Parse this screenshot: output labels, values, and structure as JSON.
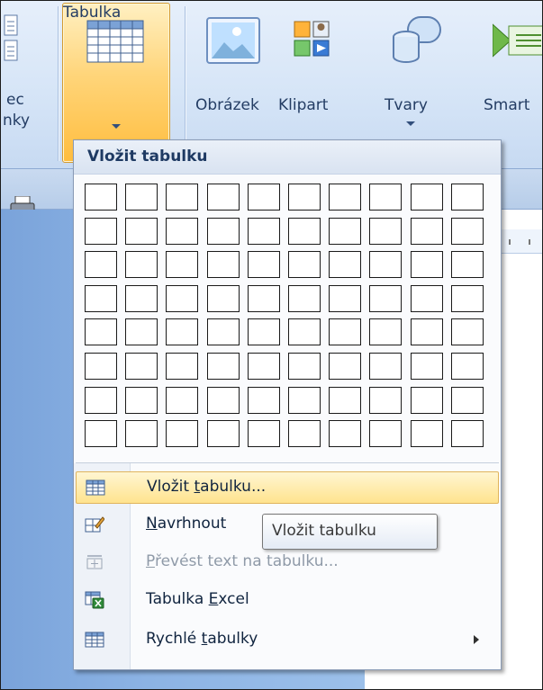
{
  "ribbon": {
    "partial_left_line1": "ec",
    "partial_left_line2": "nky",
    "buttons": {
      "tabulka": "Tabulka",
      "obrazek": "Obrázek",
      "klipart": "Klipart",
      "tvary": "Tvary",
      "smartart": "Smart"
    }
  },
  "menu": {
    "header": "Vložit tabulku",
    "grid": {
      "columns": 10,
      "rows": 8
    },
    "items": [
      {
        "pre": "Vložit ",
        "u": "t",
        "post": "abulku...",
        "icon": "table-icon",
        "highlighted": true,
        "enabled": true
      },
      {
        "pre": "",
        "u": "N",
        "post": "avrhnout",
        "icon": "draw-table-icon",
        "highlighted": false,
        "enabled": true
      },
      {
        "pre": "",
        "u": "P",
        "post": "řevést text na tabulku...",
        "icon": "convert-text-icon",
        "highlighted": false,
        "enabled": false
      },
      {
        "pre": "Tabulka ",
        "u": "E",
        "post": "xcel",
        "icon": "excel-table-icon",
        "highlighted": false,
        "enabled": true
      },
      {
        "pre": "Rychlé ",
        "u": "t",
        "post": "abulky",
        "icon": "quick-tables-icon",
        "highlighted": false,
        "enabled": true,
        "submenu": true
      }
    ]
  },
  "tooltip": {
    "text": "Vložit tabulku"
  }
}
